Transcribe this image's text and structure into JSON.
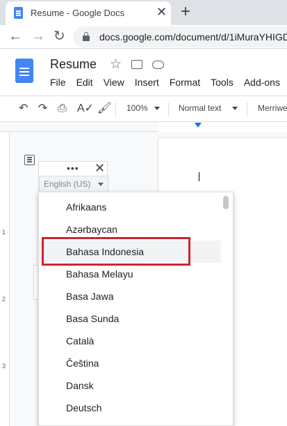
{
  "browser": {
    "tab_title": "Resume - Google Docs",
    "url": "docs.google.com/document/d/1iMuraYHIGD",
    "close_tab_glyph": "✕",
    "new_tab_glyph": "+"
  },
  "docs": {
    "title": "Resume",
    "menu": [
      "File",
      "Edit",
      "View",
      "Insert",
      "Format",
      "Tools",
      "Add-ons"
    ]
  },
  "toolbar": {
    "zoom": "100%",
    "style": "Normal text",
    "font": "Merriwe"
  },
  "ruler": {
    "vertical_numbers": [
      "1",
      "2",
      "3"
    ]
  },
  "spell_popup": {
    "language": "English (US)"
  },
  "language_list": {
    "items": [
      "Afrikaans",
      "Azərbaycan",
      "Bahasa Indonesia",
      "Bahasa Melayu",
      "Basa Jawa",
      "Basa Sunda",
      "Català",
      "Čeština",
      "Dansk",
      "Deutsch"
    ],
    "highlighted": "Bahasa Indonesia"
  },
  "colors": {
    "highlight_border": "#d2222d",
    "accent": "#1a73e8",
    "docs_blue": "#4285f4"
  },
  "icons": [
    "docs-favicon-icon",
    "close-icon",
    "plus-icon",
    "back-arrow-icon",
    "forward-arrow-icon",
    "reload-icon",
    "lock-icon",
    "docs-logo-icon",
    "star-icon",
    "move-to-folder-icon",
    "cloud-status-icon",
    "undo-icon",
    "redo-icon",
    "print-icon",
    "spellcheck-icon",
    "paint-format-icon",
    "document-outline-icon",
    "more-options-icon"
  ]
}
